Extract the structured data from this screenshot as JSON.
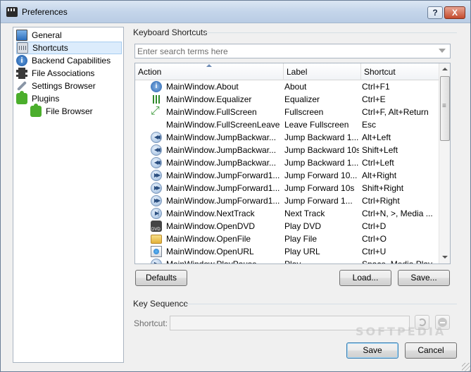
{
  "window": {
    "title": "Preferences",
    "help_label": "?",
    "close_label": "X"
  },
  "sidebar": {
    "items": [
      {
        "label": "General",
        "icon": "monitor-icon",
        "selected": false
      },
      {
        "label": "Shortcuts",
        "icon": "keyboard-icon",
        "selected": true
      },
      {
        "label": "Backend Capabilities",
        "icon": "info-icon",
        "selected": false
      },
      {
        "label": "File Associations",
        "icon": "film-icon",
        "selected": false
      },
      {
        "label": "Settings Browser",
        "icon": "wrench-icon",
        "selected": false
      },
      {
        "label": "Plugins",
        "icon": "puzzle-icon",
        "selected": false
      },
      {
        "label": "File Browser",
        "icon": "puzzle-icon",
        "selected": false
      }
    ]
  },
  "shortcuts": {
    "group_title": "Keyboard Shortcuts",
    "search_placeholder": "Enter search terms here",
    "columns": {
      "action": "Action",
      "label": "Label",
      "shortcut": "Shortcut"
    },
    "rows": [
      {
        "icon": "info-icon",
        "action": "MainWindow.About",
        "label": "About",
        "shortcut": "Ctrl+F1"
      },
      {
        "icon": "equalizer-icon",
        "action": "MainWindow.Equalizer",
        "label": "Equalizer",
        "shortcut": "Ctrl+E"
      },
      {
        "icon": "fullscreen-icon",
        "action": "MainWindow.FullScreen",
        "label": "Fullscreen",
        "shortcut": "Ctrl+F, Alt+Return"
      },
      {
        "icon": "",
        "action": "MainWindow.FullScreenLeave",
        "label": "Leave Fullscreen",
        "shortcut": "Esc"
      },
      {
        "icon": "seek-backward-icon",
        "action": "MainWindow.JumpBackwar...",
        "label": "Jump Backward 1...",
        "shortcut": "Alt+Left"
      },
      {
        "icon": "seek-backward-icon",
        "action": "MainWindow.JumpBackwar...",
        "label": "Jump Backward 10s",
        "shortcut": "Shift+Left"
      },
      {
        "icon": "seek-backward-icon",
        "action": "MainWindow.JumpBackwar...",
        "label": "Jump Backward 1...",
        "shortcut": "Ctrl+Left"
      },
      {
        "icon": "seek-forward-icon",
        "action": "MainWindow.JumpForward1...",
        "label": "Jump Forward 10...",
        "shortcut": "Alt+Right"
      },
      {
        "icon": "seek-forward-icon",
        "action": "MainWindow.JumpForward1...",
        "label": "Jump Forward 10s",
        "shortcut": "Shift+Right"
      },
      {
        "icon": "seek-forward-icon",
        "action": "MainWindow.JumpForward1...",
        "label": "Jump Forward 1...",
        "shortcut": "Ctrl+Right"
      },
      {
        "icon": "next-track-icon",
        "action": "MainWindow.NextTrack",
        "label": "Next Track",
        "shortcut": "Ctrl+N, >, Media ..."
      },
      {
        "icon": "dvd-icon",
        "action": "MainWindow.OpenDVD",
        "label": "Play DVD",
        "shortcut": "Ctrl+D"
      },
      {
        "icon": "folder-icon",
        "action": "MainWindow.OpenFile",
        "label": "Play File",
        "shortcut": "Ctrl+O"
      },
      {
        "icon": "url-icon",
        "action": "MainWindow.OpenURL",
        "label": "Play URL",
        "shortcut": "Ctrl+U"
      },
      {
        "icon": "play-icon",
        "action": "MainWindow.PlayPause",
        "label": "Play",
        "shortcut": "Space, Media Play"
      }
    ],
    "defaults_label": "Defaults",
    "load_label": "Load...",
    "save_label": "Save..."
  },
  "key_sequence": {
    "group_title": "Key Sequence",
    "shortcut_label": "Shortcut:",
    "shortcut_value": ""
  },
  "footer": {
    "save_label": "Save",
    "cancel_label": "Cancel"
  },
  "watermark": "SOFTPEDIA"
}
